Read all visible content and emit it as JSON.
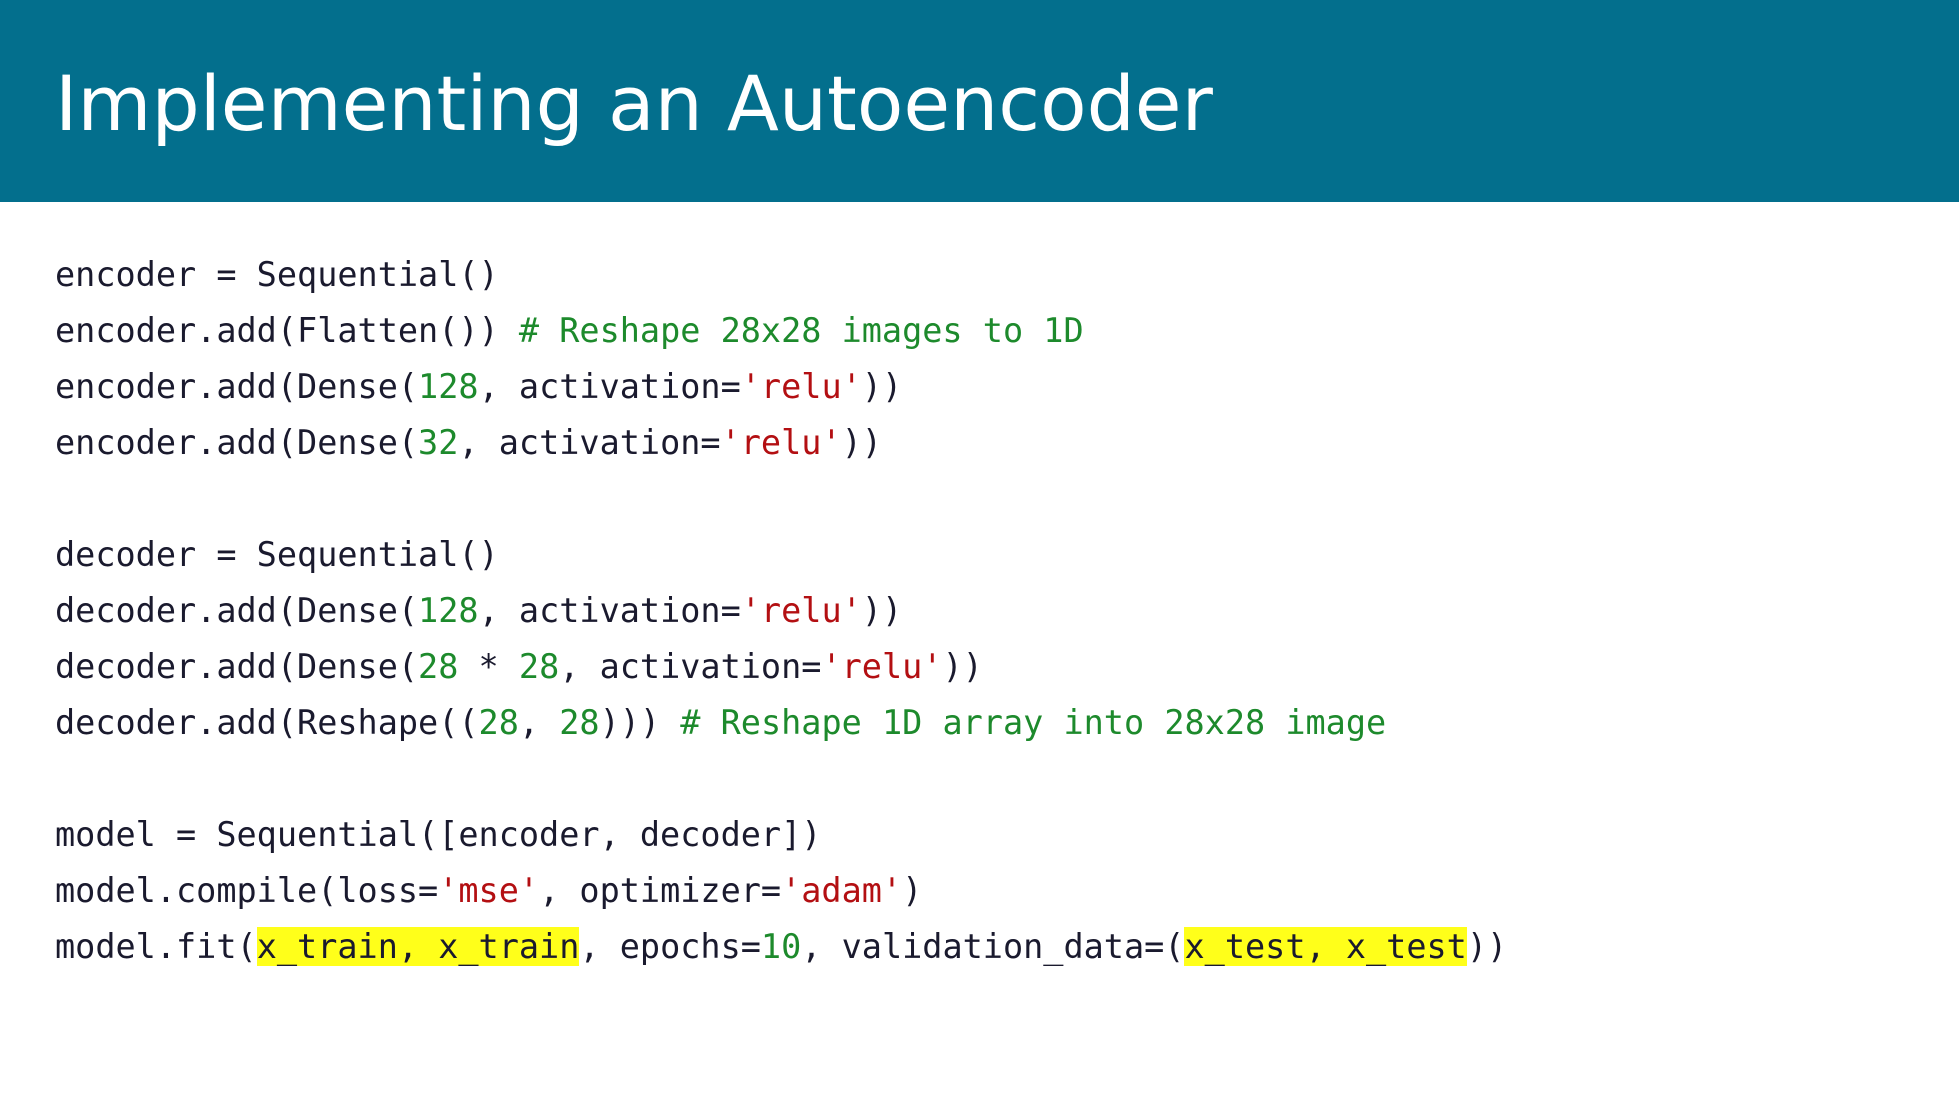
{
  "slide": {
    "title": "Implementing an Autoencoder"
  },
  "colors": {
    "title_bar": "#036f8d",
    "title_text": "#ffffff",
    "code_text": "#1a1a2e",
    "comment": "#1d8a2c",
    "number": "#1d8a2c",
    "string": "#b30f12",
    "highlight": "#ffff1a"
  },
  "code": {
    "lines": [
      [
        {
          "t": "encoder = Sequential()"
        }
      ],
      [
        {
          "t": "encoder.add(Flatten()) "
        },
        {
          "t": "# Reshape 28x28 images to 1D",
          "k": "cm"
        }
      ],
      [
        {
          "t": "encoder.add(Dense("
        },
        {
          "t": "128",
          "k": "num"
        },
        {
          "t": ", activation="
        },
        {
          "t": "'relu'",
          "k": "str"
        },
        {
          "t": "))"
        }
      ],
      [
        {
          "t": "encoder.add(Dense("
        },
        {
          "t": "32",
          "k": "num"
        },
        {
          "t": ", activation="
        },
        {
          "t": "'relu'",
          "k": "str"
        },
        {
          "t": "))"
        }
      ],
      [],
      [
        {
          "t": "decoder = Sequential()"
        }
      ],
      [
        {
          "t": "decoder.add(Dense("
        },
        {
          "t": "128",
          "k": "num"
        },
        {
          "t": ", activation="
        },
        {
          "t": "'relu'",
          "k": "str"
        },
        {
          "t": "))"
        }
      ],
      [
        {
          "t": "decoder.add(Dense("
        },
        {
          "t": "28",
          "k": "num"
        },
        {
          "t": " * "
        },
        {
          "t": "28",
          "k": "num"
        },
        {
          "t": ", activation="
        },
        {
          "t": "'relu'",
          "k": "str"
        },
        {
          "t": "))"
        }
      ],
      [
        {
          "t": "decoder.add(Reshape(("
        },
        {
          "t": "28",
          "k": "num"
        },
        {
          "t": ", "
        },
        {
          "t": "28",
          "k": "num"
        },
        {
          "t": "))) "
        },
        {
          "t": "# Reshape 1D array into 28x28 image",
          "k": "cm"
        }
      ],
      [],
      [
        {
          "t": "model = Sequential([encoder, decoder])"
        }
      ],
      [
        {
          "t": "model.compile(loss="
        },
        {
          "t": "'mse'",
          "k": "str"
        },
        {
          "t": ", optimizer="
        },
        {
          "t": "'adam'",
          "k": "str"
        },
        {
          "t": ")"
        }
      ],
      [
        {
          "t": "model.fit("
        },
        {
          "t": "x_train, x_train",
          "k": "hl"
        },
        {
          "t": ", epochs="
        },
        {
          "t": "10",
          "k": "num"
        },
        {
          "t": ", validation_data=("
        },
        {
          "t": "x_test, x_test",
          "k": "hl"
        },
        {
          "t": "))"
        }
      ]
    ]
  }
}
